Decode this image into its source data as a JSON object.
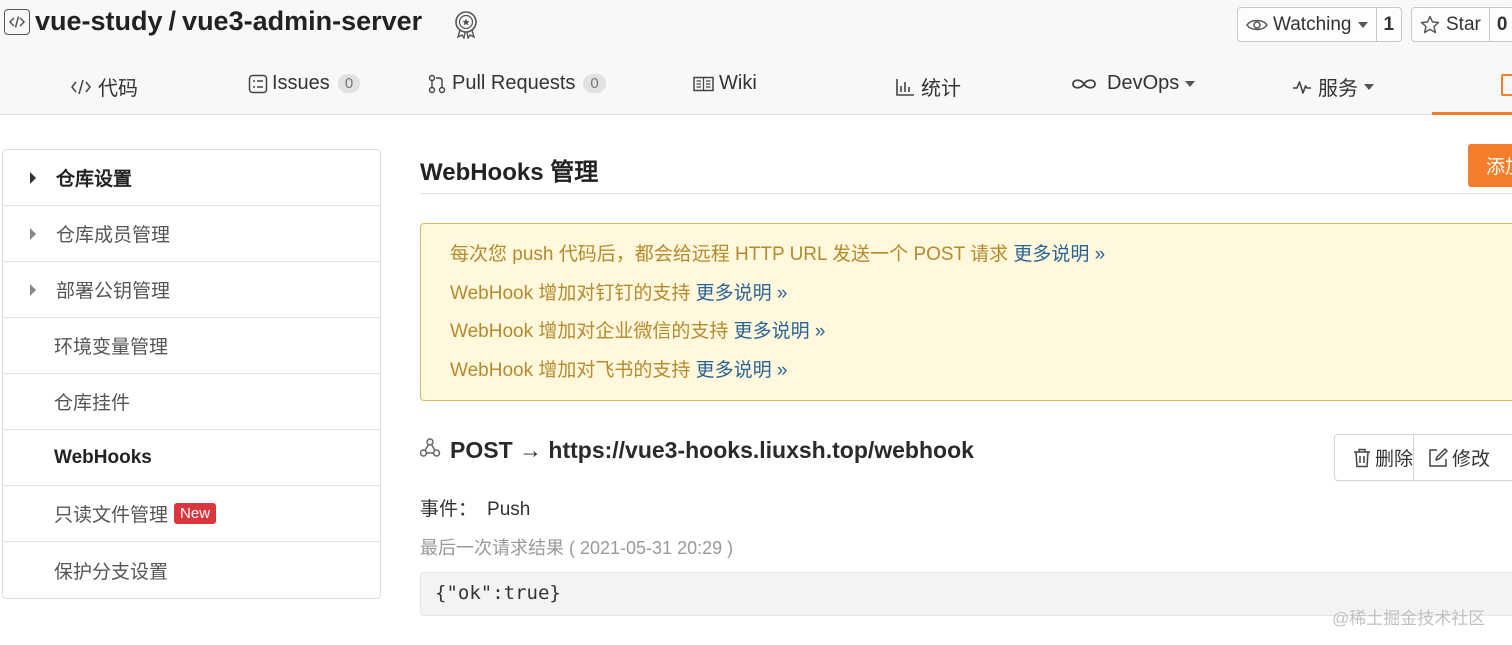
{
  "repo": {
    "owner": "vue-study",
    "separator": "/",
    "name": "vue3-admin-server",
    "watch_label": "Watching",
    "watch_count": "1",
    "star_label": "Star",
    "star_count": "0"
  },
  "tabs": [
    {
      "label": "代码",
      "icon": "code-icon"
    },
    {
      "label": "Issues",
      "count": "0",
      "icon": "issues-icon"
    },
    {
      "label": "Pull Requests",
      "count": "0",
      "icon": "pull-request-icon"
    },
    {
      "label": "Wiki",
      "icon": "book-icon"
    },
    {
      "label": "统计",
      "icon": "chart-icon"
    },
    {
      "label": "DevOps",
      "icon": "infinity-icon"
    },
    {
      "label": "服务",
      "icon": "pulse-icon"
    }
  ],
  "sidebar": {
    "items": [
      {
        "label": "仓库设置"
      },
      {
        "label": "仓库成员管理"
      },
      {
        "label": "部署公钥管理"
      },
      {
        "label": "环境变量管理"
      },
      {
        "label": "仓库挂件"
      },
      {
        "label": "WebHooks"
      },
      {
        "label": "只读文件管理",
        "badge": "New"
      },
      {
        "label": "保护分支设置"
      }
    ]
  },
  "main": {
    "title": "WebHooks 管理",
    "add_label": "添加",
    "notices": [
      {
        "text": "每次您 push 代码后，都会给远程 HTTP URL 发送一个 POST 请求 ",
        "link": "更多说明 »"
      },
      {
        "text": "WebHook 增加对钉钉的支持 ",
        "link": "更多说明 »"
      },
      {
        "text": "WebHook 增加对企业微信的支持 ",
        "link": "更多说明 »"
      },
      {
        "text": "WebHook 增加对飞书的支持 ",
        "link": "更多说明 »"
      }
    ],
    "hook": {
      "url": "POST → https://vue3-hooks.liuxsh.top/webhook",
      "delete_label": "删除",
      "edit_label": "修改",
      "event_label": "事件：",
      "event_value": "Push",
      "last_result": "最后一次请求结果 ( 2021-05-31 20:29 )",
      "response": "{\"ok\":true}"
    }
  },
  "watermark": "@稀土掘金技术社区",
  "colors": {
    "accent": "#f47e2b",
    "notice_bg": "#fff8dc",
    "notice_text": "#b58a2e",
    "link": "#2a6496",
    "badge_red": "#d9363e"
  }
}
